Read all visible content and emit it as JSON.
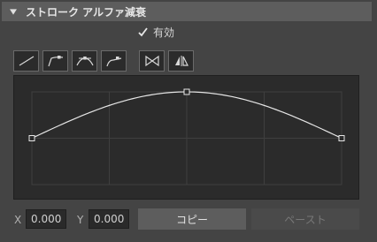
{
  "section": {
    "title": "ストローク アルファ減衰",
    "icon": "collapse-triangle-icon"
  },
  "enable": {
    "label": "有効",
    "checked": true
  },
  "presets": [
    {
      "name": "preset-linear-icon"
    },
    {
      "name": "preset-ease-in-icon"
    },
    {
      "name": "preset-ease-in-out-icon"
    },
    {
      "name": "preset-ease-out-icon"
    },
    {
      "name": "flip-horizontal-icon"
    },
    {
      "name": "mirror-icon"
    }
  ],
  "curve": {
    "points": [
      [
        0,
        0
      ],
      [
        0.5,
        1
      ],
      [
        1,
        0
      ]
    ]
  },
  "coords": {
    "x_label": "X",
    "x_value": "0.000",
    "y_label": "Y",
    "y_value": "0.000"
  },
  "buttons": {
    "copy": "コピー",
    "paste": "ペースト"
  },
  "colors": {
    "panel_bg": "#444444",
    "header_bg": "#5d5d5d",
    "curve_bg": "#2b2b2b",
    "curve_line": "#e6e6e6"
  }
}
